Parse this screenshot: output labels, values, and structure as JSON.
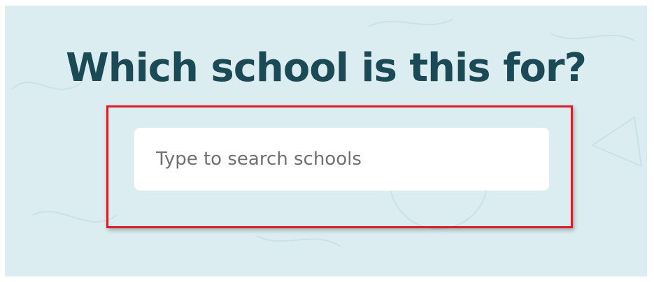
{
  "page": {
    "heading": "Which school is this for?"
  },
  "search": {
    "placeholder": "Type to search schools",
    "value": ""
  },
  "colors": {
    "panel_background": "#dcedf1",
    "heading_color": "#1b4a56",
    "highlight_border": "#d5202a",
    "input_background": "#ffffff"
  }
}
